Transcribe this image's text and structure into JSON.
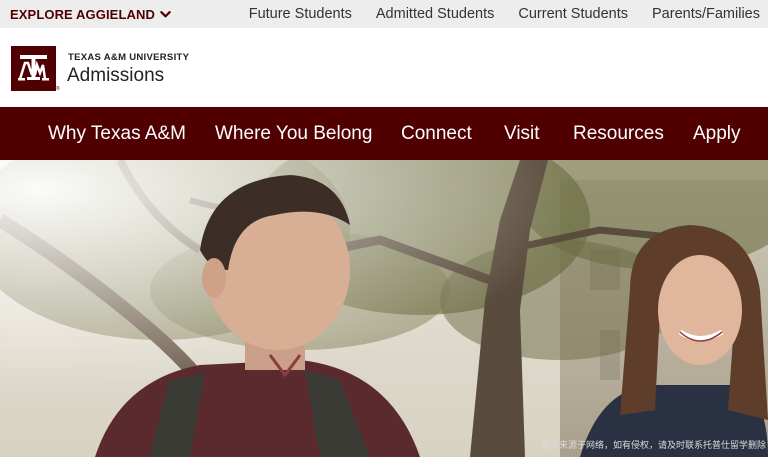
{
  "topbar": {
    "explore_label": "EXPLORE AGGIELAND",
    "links": [
      "Future Students",
      "Admitted Students",
      "Current Students",
      "Parents/Families"
    ]
  },
  "header": {
    "logo_text": "ATM",
    "university": "TEXAS A&M UNIVERSITY",
    "department": "Admissions"
  },
  "nav": {
    "items": [
      "Why Texas A&M",
      "Where You Belong",
      "Connect",
      "Visit",
      "Resources",
      "Apply"
    ]
  },
  "hero": {
    "image": "students-walking-on-campus-photo",
    "watermark": "图片来源于网络，如有侵权，请及时联系托普仕留学删除"
  },
  "colors": {
    "maroon": "#500000",
    "topbar_bg": "#ededed"
  },
  "icons": {
    "explore_chevron": "chevron-down-icon",
    "logo": "atm-logo-icon"
  }
}
